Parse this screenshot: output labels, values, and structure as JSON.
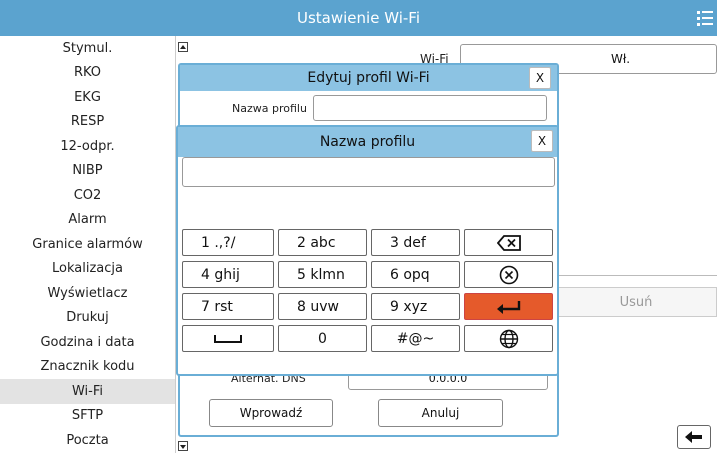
{
  "header": {
    "title": "Ustawienie Wi-Fi",
    "menu_icon": "list-menu-icon",
    "color": "#5ba3cf"
  },
  "sidebar": {
    "items": [
      {
        "label": "Stymul."
      },
      {
        "label": "RKO"
      },
      {
        "label": "EKG"
      },
      {
        "label": "RESP"
      },
      {
        "label": "12-odpr."
      },
      {
        "label": "NIBP"
      },
      {
        "label": "CO2"
      },
      {
        "label": "Alarm"
      },
      {
        "label": "Granice alarmów"
      },
      {
        "label": "Lokalizacja"
      },
      {
        "label": "Wyświetlacz"
      },
      {
        "label": "Drukuj"
      },
      {
        "label": "Godzina i data"
      },
      {
        "label": "Znacznik kodu"
      },
      {
        "label": "Wi-Fi",
        "active": true
      },
      {
        "label": "SFTP"
      },
      {
        "label": "Poczta"
      }
    ]
  },
  "background": {
    "wifi_label": "Wi-Fi",
    "wifi_value": "Wł.",
    "delete_button": "Usuń"
  },
  "edit_dialog": {
    "title": "Edytuj profil Wi-Fi",
    "close": "X",
    "profile_name_label": "Nazwa profilu",
    "profile_name_value": "",
    "alt_dns_label": "Alternat. DNS",
    "alt_dns_value": "0.0.0.0",
    "enter_button": "Wprowadź",
    "cancel_button": "Anuluj"
  },
  "keyboard_dialog": {
    "title": "Nazwa profilu",
    "close": "X",
    "input_value": "",
    "keys": {
      "k1": "1 .,?/",
      "k2": "2 abc",
      "k3": "3 def",
      "k4": "4 ghij",
      "k5": "5 klmn",
      "k6": "6 opq",
      "k7": "7 rst",
      "k8": "8 uvw",
      "k9": "9 xyz",
      "k0": "0",
      "ksym": "#@~"
    },
    "enter_color": "#e55a2b"
  }
}
